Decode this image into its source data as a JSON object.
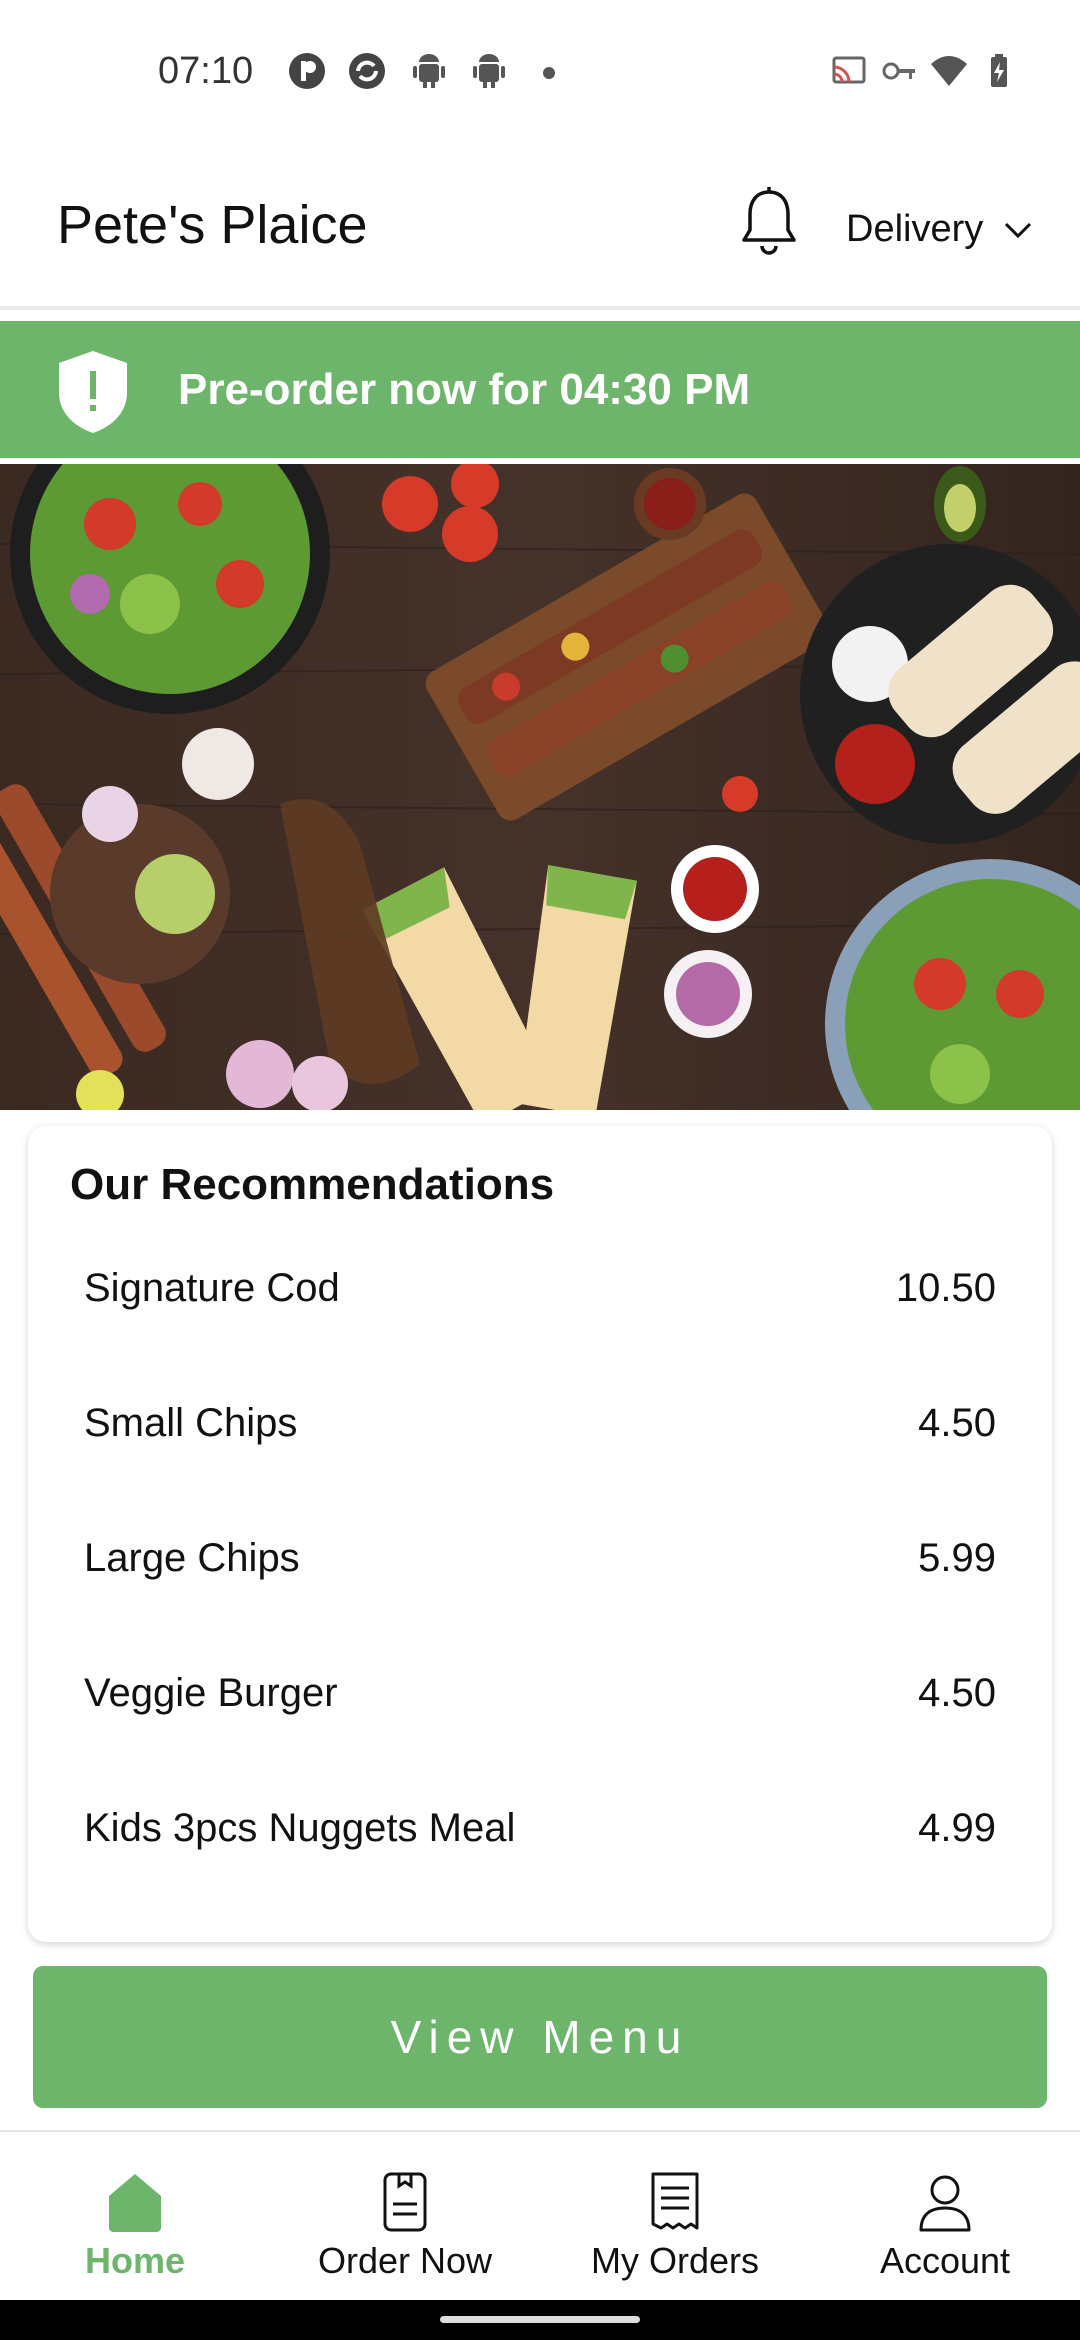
{
  "status_bar": {
    "time": "07:10",
    "icons": [
      "p-app-icon",
      "sync-icon",
      "android-icon",
      "android-icon",
      "cast-icon",
      "key-icon",
      "wifi-icon",
      "battery-charging-icon"
    ]
  },
  "app_bar": {
    "title": "Pete's Plaice",
    "mode_label": "Delivery"
  },
  "banner": {
    "text": "Pre-order now for 04:30 PM",
    "color": "#6db56a"
  },
  "recommendations": {
    "heading": "Our Recommendations",
    "items": [
      {
        "name": "Signature Cod",
        "price": "10.50"
      },
      {
        "name": "Small Chips",
        "price": "4.50"
      },
      {
        "name": "Large Chips",
        "price": "5.99"
      },
      {
        "name": "Veggie Burger",
        "price": "4.50"
      },
      {
        "name": "Kids 3pcs Nuggets Meal",
        "price": "4.99"
      }
    ]
  },
  "view_menu_label": "View Menu",
  "bottom_nav": {
    "items": [
      {
        "label": "Home",
        "icon": "home-icon",
        "active": true
      },
      {
        "label": "Order Now",
        "icon": "order-icon",
        "active": false
      },
      {
        "label": "My Orders",
        "icon": "receipt-icon",
        "active": false
      },
      {
        "label": "Account",
        "icon": "user-icon",
        "active": false
      }
    ]
  },
  "accent_color": "#6db56a"
}
